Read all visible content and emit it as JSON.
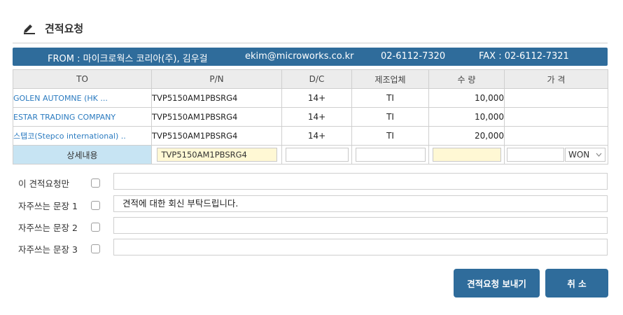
{
  "header": {
    "title": "견적요청"
  },
  "from_bar": {
    "from": "FROM : 마이크로웍스 코리아(주), 김우걸",
    "email": "ekim@microworks.co.kr",
    "phone": "02-6112-7320",
    "fax": "FAX : 02-6112-7321"
  },
  "table": {
    "columns": [
      "TO",
      "P/N",
      "D/C",
      "제조업체",
      "수 량",
      "가 격"
    ],
    "rows": [
      {
        "to": "GOLEN AUTOMNE (HK ...",
        "pn": "TVP5150AM1PBSRG4",
        "dc": "14+",
        "maker": "TI",
        "qty": "10,000",
        "price": ""
      },
      {
        "to": "ESTAR TRADING COMPANY",
        "pn": "TVP5150AM1PBSRG4",
        "dc": "14+",
        "maker": "TI",
        "qty": "10,000",
        "price": ""
      },
      {
        "to": "스탭코(Stepco international) ..",
        "pn": "TVP5150AM1PBSRG4",
        "dc": "14+",
        "maker": "TI",
        "qty": "20,000",
        "price": ""
      }
    ],
    "detail_row": {
      "label": "상세내용",
      "pn_value": "TVP5150AM1PBSRG4",
      "dc_value": "",
      "maker_value": "",
      "qty_value": "",
      "price_value": "",
      "currency": "WON"
    }
  },
  "options": [
    {
      "label": "이 견적요청만",
      "value": ""
    },
    {
      "label": "자주쓰는 문장 1",
      "value": "견적에 대한 회신 부탁드립니다."
    },
    {
      "label": "자주쓰는 문장 2",
      "value": ""
    },
    {
      "label": "자주쓰는 문장 3",
      "value": ""
    }
  ],
  "buttons": {
    "send": "견적요청 보내기",
    "cancel": "취 소"
  },
  "colors": {
    "primary": "#2f6c9b",
    "link": "#2b7bc0",
    "highlight_cell": "#c7e4f3",
    "yellow_field": "#fff8d4"
  }
}
